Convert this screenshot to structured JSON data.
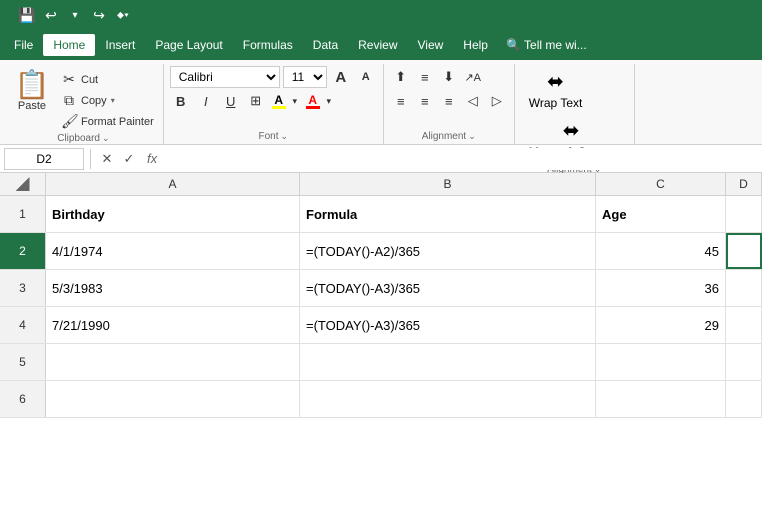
{
  "titlebar": {
    "quickaccess": {
      "save": "💾",
      "undo": "↩",
      "redo": "↪",
      "customize": "▾"
    }
  },
  "menubar": {
    "items": [
      {
        "label": "File",
        "active": false
      },
      {
        "label": "Home",
        "active": true
      },
      {
        "label": "Insert",
        "active": false
      },
      {
        "label": "Page Layout",
        "active": false
      },
      {
        "label": "Formulas",
        "active": false
      },
      {
        "label": "Data",
        "active": false
      },
      {
        "label": "Review",
        "active": false
      },
      {
        "label": "View",
        "active": false
      },
      {
        "label": "Help",
        "active": false
      },
      {
        "label": "🔍 Tell me wi",
        "active": false
      }
    ]
  },
  "ribbon": {
    "clipboard": {
      "paste": "Paste",
      "cut": "Cut",
      "copy": "Copy",
      "format_painter": "Format Painter",
      "label": "Clipboard"
    },
    "font": {
      "font_name": "Calibri",
      "font_size": "11",
      "grow_icon": "A",
      "shrink_icon": "A",
      "bold": "B",
      "italic": "I",
      "underline": "U",
      "borders": "⊞",
      "fill_color": "A",
      "fill_color_bar": "#FFFF00",
      "font_color": "A",
      "font_color_bar": "#FF0000",
      "label": "Font"
    },
    "alignment": {
      "top_align": "⊤",
      "middle_align": "≡",
      "bottom_align": "⊥",
      "left_align": "≡",
      "center_align": "≡",
      "right_align": "≡",
      "decrease_indent": "◁",
      "increase_indent": "▷",
      "orientation": "⟳",
      "label": "Alignment"
    },
    "wrap": {
      "wrap_text": "Wrap Text",
      "merge_center": "Merge & Center",
      "label": "Alignment"
    }
  },
  "formulabar": {
    "cell_ref": "D2",
    "cancel": "✕",
    "confirm": "✓",
    "fx": "fx"
  },
  "spreadsheet": {
    "columns": [
      "A",
      "B",
      "C",
      "D"
    ],
    "rows": [
      {
        "num": "1",
        "cells": [
          "Birthday",
          "Formula",
          "Age",
          ""
        ]
      },
      {
        "num": "2",
        "cells": [
          "4/1/1974",
          "=(TODAY()-A2)/365",
          "45",
          ""
        ],
        "active": true
      },
      {
        "num": "3",
        "cells": [
          "5/3/1983",
          "=(TODAY()-A3)/365",
          "36",
          ""
        ]
      },
      {
        "num": "4",
        "cells": [
          "7/21/1990",
          "=(TODAY()-A3)/365",
          "29",
          ""
        ]
      },
      {
        "num": "5",
        "cells": [
          "",
          "",
          "",
          ""
        ]
      },
      {
        "num": "6",
        "cells": [
          "",
          "",
          "",
          ""
        ]
      }
    ]
  }
}
